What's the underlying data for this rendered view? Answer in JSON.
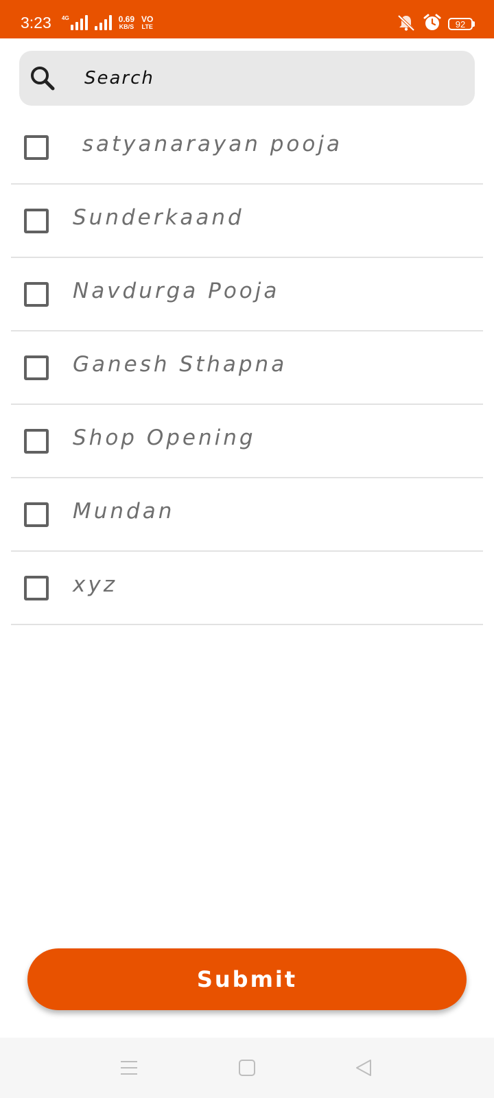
{
  "status_bar": {
    "time": "3:23",
    "network_type": "4G",
    "data_speed_value": "0.69",
    "data_speed_unit": "KB/S",
    "volte_line1": "VO",
    "volte_line2": "LTE",
    "battery": "92",
    "icons": [
      "signal-4g-icon",
      "signal-icon",
      "mute-icon",
      "alarm-icon",
      "battery-icon"
    ]
  },
  "search": {
    "placeholder": "Search",
    "icon": "search-icon"
  },
  "items": [
    {
      "label": " satyanarayan pooja",
      "checked": false
    },
    {
      "label": "Sunderkaand",
      "checked": false
    },
    {
      "label": "Navdurga Pooja",
      "checked": false
    },
    {
      "label": "Ganesh Sthapna",
      "checked": false
    },
    {
      "label": "Shop Opening",
      "checked": false
    },
    {
      "label": "Mundan",
      "checked": false
    },
    {
      "label": "xyz",
      "checked": false
    }
  ],
  "submit": {
    "label": "Submit"
  },
  "nav_bar": {
    "icons": [
      "menu-icon",
      "home-icon",
      "back-icon"
    ]
  },
  "colors": {
    "accent": "#e85200",
    "search_bg": "#e8e8e8",
    "item_text": "#6e6e6e",
    "divider": "#e2e2e2"
  }
}
